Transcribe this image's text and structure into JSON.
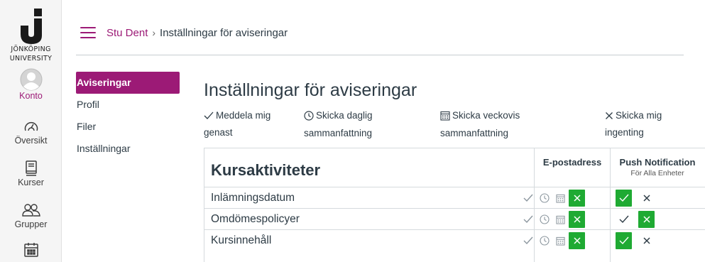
{
  "global_nav": {
    "logo_text_line1": "JÖNKÖPING",
    "logo_text_line2": "UNIVERSITY",
    "items": [
      {
        "label": "Konto",
        "icon": "avatar-icon",
        "active": true
      },
      {
        "label": "Översikt",
        "icon": "dashboard-icon"
      },
      {
        "label": "Kurser",
        "icon": "courses-icon"
      },
      {
        "label": "Grupper",
        "icon": "groups-icon"
      },
      {
        "label": "",
        "icon": "calendar-icon"
      }
    ]
  },
  "header": {
    "breadcrumb_user": "Stu Dent",
    "breadcrumb_separator": "›",
    "breadcrumb_current": "Inställningar för aviseringar"
  },
  "subnav": {
    "items": [
      {
        "label": "Aviseringar",
        "active": true
      },
      {
        "label": "Profil"
      },
      {
        "label": "Filer"
      },
      {
        "label": "Inställningar"
      }
    ]
  },
  "page": {
    "title": "Inställningar för aviseringar"
  },
  "legend": {
    "immediately_line1": "Meddela mig",
    "immediately_line2": "genast",
    "daily_line1": "Skicka daglig",
    "daily_line2": "sammanfattning",
    "weekly_line1": "Skicka veckovis",
    "weekly_line2": "sammanfattning",
    "never_line1": "Skicka mig",
    "never_line2": "ingenting"
  },
  "table": {
    "category_title": "Kursaktiviteter",
    "email_header": "E-postadress",
    "push_header": "Push Notification",
    "push_subheader": "För Alla Enheter",
    "rows": [
      {
        "label": "Inlämningsdatum",
        "email": "never",
        "push": "immediately"
      },
      {
        "label": "Omdömespolicyer",
        "email": "never",
        "push": "never"
      },
      {
        "label": "Kursinnehåll",
        "email": "never",
        "push": "immediately"
      }
    ]
  },
  "colors": {
    "brand": "#9c1a76",
    "selected_green": "#1faa33"
  }
}
